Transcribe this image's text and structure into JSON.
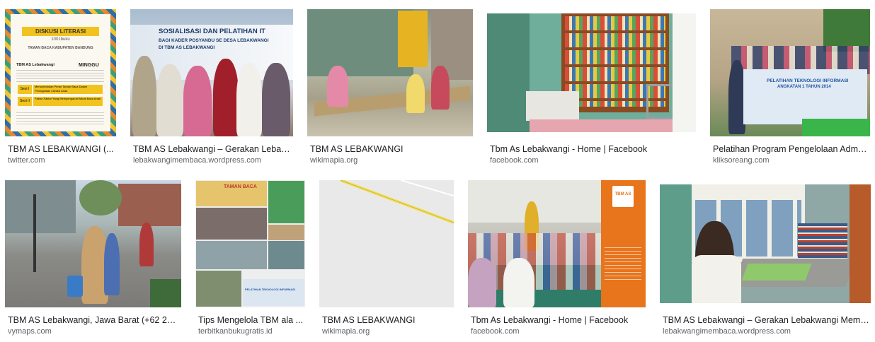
{
  "results": [
    {
      "title": "TBM AS LEBAKWANGI (...",
      "source": "twitter.com",
      "poster": {
        "heading": "DISKUSI LITERASI",
        "sub": "1001buku",
        "org": "TAMAN BACA KABUPATEN BANDUNG",
        "day": "MINGGU",
        "brand": "TBM AS Lebakwangi",
        "label1": "Sesi I",
        "label2": "Sesi II",
        "topic1": "Menumbuhkan Peran Taman Baca Dalam Peningkatan Literasi Anak",
        "topic2": "Faktor-Faktor Yang Mempengaruhi Minat Baca Anak"
      }
    },
    {
      "title": "TBM AS Lebakwangi – Gerakan Lebak...",
      "source": "lebakwangimembaca.wordpress.com",
      "banner": {
        "line1": "SOSIALISASI DAN PELATIHAN IT",
        "line2": "BAGI KADER POSYANDU SE DESA LEBAKWANGI",
        "line3": "DI TBM AS LEBAKWANGI"
      }
    },
    {
      "title": "TBM AS LEBAKWANGI",
      "source": "wikimapia.org"
    },
    {
      "title": "Tbm As Lebakwangi - Home | Facebook",
      "source": "facebook.com"
    },
    {
      "title": "Pelatihan Program Pengelolaan Admi...",
      "source": "kliksoreang.com",
      "banner": {
        "line1": "PELATIHAN TEKNOLOGI INFORMASI",
        "line2": "ANGKATAN 1 TAHUN 2014"
      }
    },
    {
      "title": "TBM AS Lebakwangi, Jawa Barat (+62 22 ...",
      "source": "vymaps.com"
    },
    {
      "title": "Tips Mengelola TBM ala ...",
      "source": "terbitkanbukugratis.id",
      "banner": {
        "line1": "TAMAN BACA",
        "line2": "PELATIHAN TEKNOLOGI INFORMASI"
      }
    },
    {
      "title": "TBM AS LEBAKWANGI",
      "source": "wikimapia.org"
    },
    {
      "title": "Tbm As Lebakwangi - Home | Facebook",
      "source": "facebook.com",
      "logo": "TBM AS"
    },
    {
      "title": "TBM AS Lebakwangi – Gerakan Lebakwangi Memb...",
      "source": "lebakwangimembaca.wordpress.com"
    }
  ]
}
